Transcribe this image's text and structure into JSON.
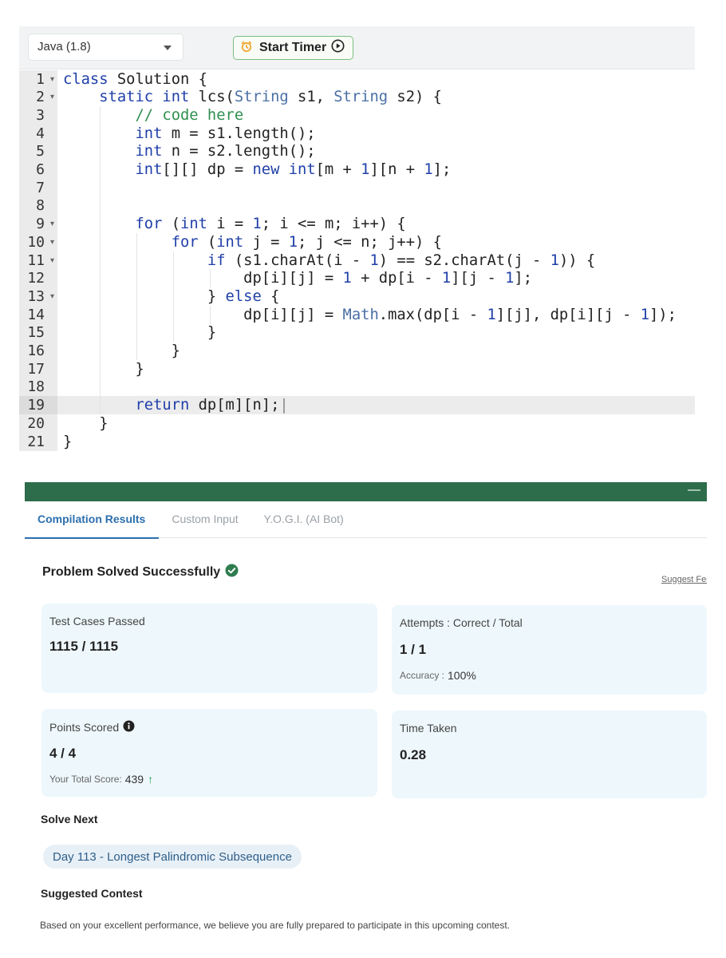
{
  "editor": {
    "language": "Java (1.8)",
    "timer_label": "Start Timer",
    "active_line": 19,
    "lines": [
      {
        "n": "1",
        "fold": true,
        "tokens": [
          [
            "class",
            "#1f3fa8"
          ],
          [
            " Solution {",
            "#222"
          ]
        ]
      },
      {
        "n": "2",
        "fold": true,
        "tokens": [
          [
            "    ",
            "#222"
          ],
          [
            "static",
            "#1f3fa8"
          ],
          [
            " ",
            "#222"
          ],
          [
            "int",
            "#1f3fa8"
          ],
          [
            " lcs(",
            "#222"
          ],
          [
            "String",
            "#4a6fa5"
          ],
          [
            " s1, ",
            "#222"
          ],
          [
            "String",
            "#4a6fa5"
          ],
          [
            " s2) {",
            "#222"
          ]
        ]
      },
      {
        "n": "3",
        "fold": false,
        "tokens": [
          [
            "        ",
            "#222"
          ],
          [
            "// code here",
            "#2f8f4f"
          ]
        ]
      },
      {
        "n": "4",
        "fold": false,
        "tokens": [
          [
            "        ",
            "#222"
          ],
          [
            "int",
            "#1f3fa8"
          ],
          [
            " m = s1.length();",
            "#222"
          ]
        ]
      },
      {
        "n": "5",
        "fold": false,
        "tokens": [
          [
            "        ",
            "#222"
          ],
          [
            "int",
            "#1f3fa8"
          ],
          [
            " n = s2.length();",
            "#222"
          ]
        ]
      },
      {
        "n": "6",
        "fold": false,
        "tokens": [
          [
            "        ",
            "#222"
          ],
          [
            "int",
            "#1f3fa8"
          ],
          [
            "[][] dp = ",
            "#222"
          ],
          [
            "new",
            "#1f3fa8"
          ],
          [
            " ",
            "#222"
          ],
          [
            "int",
            "#1f3fa8"
          ],
          [
            "[m + ",
            "#222"
          ],
          [
            "1",
            "#1f3fa8"
          ],
          [
            "][n + ",
            "#222"
          ],
          [
            "1",
            "#1f3fa8"
          ],
          [
            "];",
            "#222"
          ]
        ]
      },
      {
        "n": "7",
        "fold": false,
        "tokens": []
      },
      {
        "n": "8",
        "fold": false,
        "tokens": []
      },
      {
        "n": "9",
        "fold": true,
        "tokens": [
          [
            "        ",
            "#222"
          ],
          [
            "for",
            "#1f3fa8"
          ],
          [
            " (",
            "#222"
          ],
          [
            "int",
            "#1f3fa8"
          ],
          [
            " i = ",
            "#222"
          ],
          [
            "1",
            "#1f3fa8"
          ],
          [
            "; i <= m; i++) {",
            "#222"
          ]
        ]
      },
      {
        "n": "10",
        "fold": true,
        "tokens": [
          [
            "            ",
            "#222"
          ],
          [
            "for",
            "#1f3fa8"
          ],
          [
            " (",
            "#222"
          ],
          [
            "int",
            "#1f3fa8"
          ],
          [
            " j = ",
            "#222"
          ],
          [
            "1",
            "#1f3fa8"
          ],
          [
            "; j <= n; j++) {",
            "#222"
          ]
        ]
      },
      {
        "n": "11",
        "fold": true,
        "tokens": [
          [
            "                ",
            "#222"
          ],
          [
            "if",
            "#1f3fa8"
          ],
          [
            " (s1.charAt(i - ",
            "#222"
          ],
          [
            "1",
            "#1f3fa8"
          ],
          [
            ") == s2.charAt(j - ",
            "#222"
          ],
          [
            "1",
            "#1f3fa8"
          ],
          [
            ")) {",
            "#222"
          ]
        ]
      },
      {
        "n": "12",
        "fold": false,
        "tokens": [
          [
            "                    dp[i][j] = ",
            "#222"
          ],
          [
            "1",
            "#1f3fa8"
          ],
          [
            " + dp[i - ",
            "#222"
          ],
          [
            "1",
            "#1f3fa8"
          ],
          [
            "][j - ",
            "#222"
          ],
          [
            "1",
            "#1f3fa8"
          ],
          [
            "];",
            "#222"
          ]
        ]
      },
      {
        "n": "13",
        "fold": true,
        "tokens": [
          [
            "                } ",
            "#222"
          ],
          [
            "else",
            "#1f3fa8"
          ],
          [
            " {",
            "#222"
          ]
        ]
      },
      {
        "n": "14",
        "fold": false,
        "tokens": [
          [
            "                    dp[i][j] = ",
            "#222"
          ],
          [
            "Math",
            "#4a6fa5"
          ],
          [
            ".max(dp[i - ",
            "#222"
          ],
          [
            "1",
            "#1f3fa8"
          ],
          [
            "][j], dp[i][j - ",
            "#222"
          ],
          [
            "1",
            "#1f3fa8"
          ],
          [
            "]);",
            "#222"
          ]
        ]
      },
      {
        "n": "15",
        "fold": false,
        "tokens": [
          [
            "                }",
            "#222"
          ]
        ]
      },
      {
        "n": "16",
        "fold": false,
        "tokens": [
          [
            "            }",
            "#222"
          ]
        ]
      },
      {
        "n": "17",
        "fold": false,
        "tokens": [
          [
            "        }",
            "#222"
          ]
        ]
      },
      {
        "n": "18",
        "fold": false,
        "tokens": []
      },
      {
        "n": "19",
        "fold": false,
        "tokens": [
          [
            "        ",
            "#222"
          ],
          [
            "return",
            "#1f3fa8"
          ],
          [
            " dp[m][n];",
            "#222"
          ]
        ]
      },
      {
        "n": "20",
        "fold": false,
        "tokens": [
          [
            "    }",
            "#222"
          ]
        ]
      },
      {
        "n": "21",
        "fold": false,
        "tokens": [
          [
            "}",
            "#222"
          ]
        ]
      }
    ]
  },
  "results": {
    "tabs": [
      "Compilation Results",
      "Custom Input",
      "Y.O.G.I. (AI Bot)"
    ],
    "active_tab": 0,
    "status": "Problem Solved Successfully",
    "suggest_link": "Suggest Feedback",
    "test_cases": {
      "label": "Test Cases Passed",
      "value": "1115 / 1115"
    },
    "attempts": {
      "label": "Attempts : Correct / Total",
      "value": "1 / 1",
      "accuracy_label": "Accuracy :",
      "accuracy_value": "100%"
    },
    "points": {
      "label": "Points Scored",
      "value": "4 / 4",
      "total_label": "Your Total Score:",
      "total_value": "439"
    },
    "time_taken": {
      "label": "Time Taken",
      "value": "0.28"
    },
    "solve_next": {
      "heading": "Solve Next",
      "item": "Day 113 - Longest Palindromic Subsequence"
    },
    "suggested_contest": {
      "heading": "Suggested Contest",
      "description": "Based on your excellent performance, we believe you are fully prepared to participate in this upcoming contest."
    }
  },
  "colors": {
    "header_green": "#2d6d4c",
    "tab_blue": "#2c6fad",
    "success_green": "#2e7d4f",
    "card_bg": "#eef8fc"
  }
}
